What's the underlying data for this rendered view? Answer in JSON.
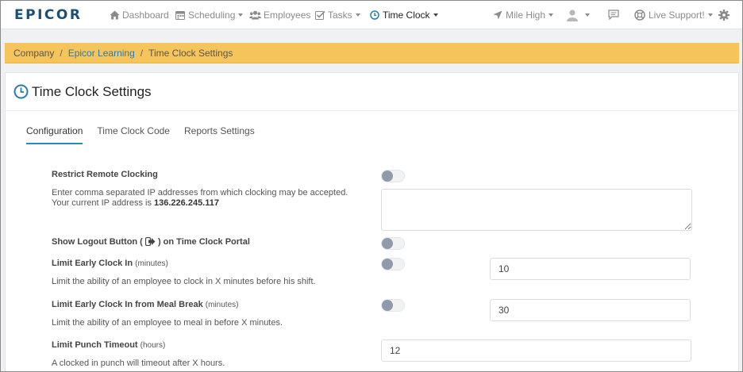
{
  "nav": {
    "logo": "EPICOR",
    "items": [
      {
        "label": "Dashboard"
      },
      {
        "label": "Scheduling"
      },
      {
        "label": "Employees"
      },
      {
        "label": "Tasks"
      },
      {
        "label": "Time Clock"
      },
      {
        "label": "Mile High"
      },
      {
        "label": "Live Support!"
      }
    ]
  },
  "breadcrumb": {
    "items": [
      "Company",
      "Epicor Learning",
      "Time Clock Settings"
    ],
    "separator": "/"
  },
  "page": {
    "title": "Time Clock Settings"
  },
  "tabs": [
    "Configuration",
    "Time Clock Code",
    "Reports Settings"
  ],
  "settings": {
    "restrict_remote": {
      "label": "Restrict Remote Clocking",
      "desc_line1": "Enter comma separated IP addresses from which clocking may be accepted.",
      "desc_line2_prefix": "Your current IP address is ",
      "ip": "136.226.245.117",
      "textarea_value": ""
    },
    "logout_button": {
      "label_prefix": "Show Logout Button ( ",
      "label_suffix": " ) on Time Clock Portal"
    },
    "early_clock_in": {
      "label": "Limit Early Clock In",
      "unit": "(minutes)",
      "value": "10",
      "desc": "Limit the ability of an employee to clock in X minutes before his shift."
    },
    "early_meal": {
      "label": "Limit Early Clock In from Meal Break",
      "unit": "(minutes)",
      "value": "30",
      "desc": "Limit the ability of an employee to meal in before X minutes."
    },
    "punch_timeout": {
      "label": "Limit Punch Timeout",
      "unit": "(hours)",
      "value": "12",
      "desc": "A clocked in punch will timeout after X hours."
    }
  },
  "colors": {
    "brand": "#1a4f7a",
    "accent": "#2a8bb5",
    "breadcrumb_bg": "#f5c55b",
    "toggle_knob": "#8f9aab"
  },
  "icons": {
    "dashboard": "home-icon",
    "scheduling": "calendar-icon",
    "employees": "users-icon",
    "tasks": "checkbox-icon",
    "time_clock": "clock-icon",
    "location": "location-arrow-icon",
    "user": "user-icon",
    "messages": "chat-icon",
    "support": "lifebuoy-icon",
    "settings": "gear-icon"
  }
}
